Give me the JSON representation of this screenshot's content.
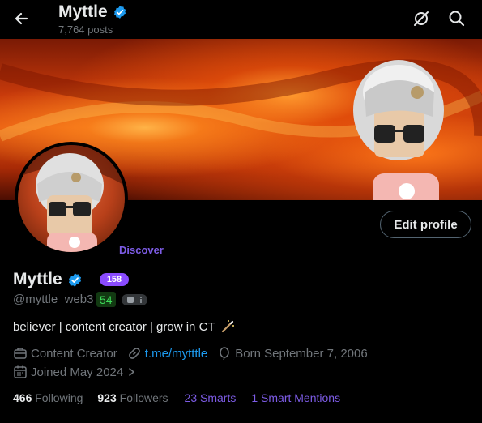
{
  "header": {
    "name": "Myttle",
    "posts": "7,764 posts"
  },
  "profile": {
    "display_name": "Myttle",
    "handle": "@myttle_web3",
    "badge_count": "158",
    "score": "54",
    "discover_label": "Discover",
    "edit_button": "Edit profile",
    "bio": "believer | content creator | grow in CT",
    "category": "Content Creator",
    "link": "t.me/mytttle",
    "born": "Born September 7, 2006",
    "joined": "Joined May 2024"
  },
  "stats": {
    "following_count": "466",
    "following_label": "Following",
    "followers_count": "923",
    "followers_label": "Followers",
    "smarts": "23 Smarts",
    "smart_mentions": "1 Smart Mentions"
  },
  "colors": {
    "verified": "#1d9bf0",
    "accent_purple": "#7d5ce6",
    "link": "#1d9bf0",
    "banner": "#e85a12"
  },
  "icons": [
    "back-arrow-icon",
    "verified-icon",
    "no-sync-icon",
    "search-icon",
    "briefcase-icon",
    "link-icon",
    "balloon-icon",
    "calendar-icon",
    "chevron-right-icon",
    "magic-wand-icon"
  ]
}
